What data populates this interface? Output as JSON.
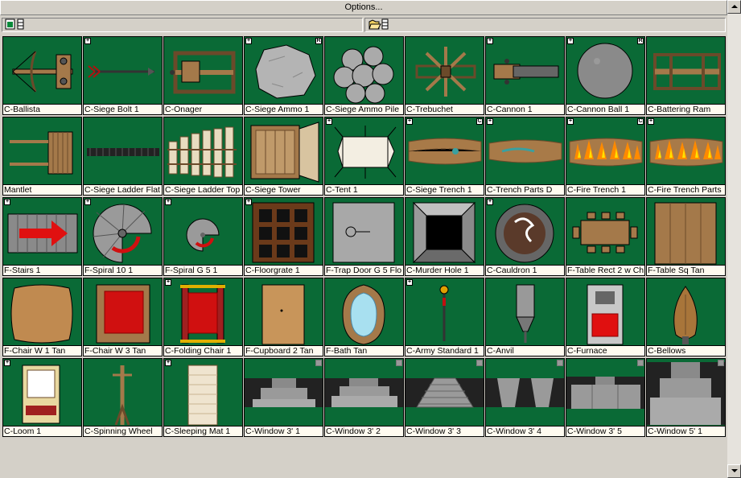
{
  "window": {
    "title": "Options..."
  },
  "colors": {
    "cell_bg": "#0a6a36",
    "panel": "#d4d0c8"
  },
  "symbols": [
    {
      "label": "C-Ballista",
      "badge_l": "",
      "badge_r": "",
      "art": "ballista"
    },
    {
      "label": "C-Siege Bolt 1",
      "badge_l": "+",
      "badge_r": "",
      "art": "bolt"
    },
    {
      "label": "C-Onager",
      "badge_l": "",
      "badge_r": "",
      "art": "onager"
    },
    {
      "label": "C-Siege Ammo 1",
      "badge_l": "+",
      "badge_r": "R",
      "art": "rock"
    },
    {
      "label": "C-Siege Ammo Pile",
      "badge_l": "",
      "badge_r": "",
      "art": "rockpile"
    },
    {
      "label": "C-Trebuchet",
      "badge_l": "",
      "badge_r": "",
      "art": "trebuchet"
    },
    {
      "label": "C-Cannon 1",
      "badge_l": "+",
      "badge_r": "",
      "art": "cannon"
    },
    {
      "label": "C-Cannon Ball 1",
      "badge_l": "+",
      "badge_r": "R",
      "art": "ball"
    },
    {
      "label": "C-Battering Ram",
      "badge_l": "",
      "badge_r": "",
      "art": "ram"
    },
    {
      "label": "Mantlet",
      "badge_l": "",
      "badge_r": "",
      "art": "mantlet"
    },
    {
      "label": "C-Siege Ladder Flat",
      "badge_l": "",
      "badge_r": "",
      "art": "ladderflat"
    },
    {
      "label": "C-Siege Ladder Top",
      "badge_l": "",
      "badge_r": "",
      "art": "laddertop"
    },
    {
      "label": "C-Siege Tower",
      "badge_l": "",
      "badge_r": "",
      "art": "tower"
    },
    {
      "label": "C-Tent 1",
      "badge_l": "+",
      "badge_r": "",
      "art": "tent"
    },
    {
      "label": "C-Siege Trench 1",
      "badge_l": "+",
      "badge_r": "C",
      "art": "trench"
    },
    {
      "label": "C-Trench Parts D",
      "badge_l": "+",
      "badge_r": "",
      "art": "trenchparts"
    },
    {
      "label": "C-Fire Trench 1",
      "badge_l": "+",
      "badge_r": "C",
      "art": "firetrench"
    },
    {
      "label": "C-Fire Trench Parts",
      "badge_l": "+",
      "badge_r": "",
      "art": "firetrench"
    },
    {
      "label": "F-Stairs 1",
      "badge_l": "+",
      "badge_r": "",
      "art": "stairs"
    },
    {
      "label": "F-Spiral 10 1",
      "badge_l": "+",
      "badge_r": "",
      "art": "spiral"
    },
    {
      "label": "F-Spiral G 5 1",
      "badge_l": "+",
      "badge_r": "",
      "art": "spiralsmall"
    },
    {
      "label": "C-Floorgrate 1",
      "badge_l": "+",
      "badge_r": "",
      "art": "grate"
    },
    {
      "label": "F-Trap Door G 5 Flo",
      "badge_l": "",
      "badge_r": "",
      "art": "trapdoor"
    },
    {
      "label": "C-Murder Hole 1",
      "badge_l": "",
      "badge_r": "",
      "art": "murderhole"
    },
    {
      "label": "C-Cauldron 1",
      "badge_l": "+",
      "badge_r": "",
      "art": "cauldron"
    },
    {
      "label": "F-Table Rect 2 w Ch",
      "badge_l": "",
      "badge_r": "",
      "art": "tablerect"
    },
    {
      "label": "F-Table Sq Tan",
      "badge_l": "",
      "badge_r": "",
      "art": "tablesq"
    },
    {
      "label": "F-Chair W 1 Tan",
      "badge_l": "",
      "badge_r": "",
      "art": "cushion"
    },
    {
      "label": "F-Chair W 3 Tan",
      "badge_l": "",
      "badge_r": "",
      "art": "chair3"
    },
    {
      "label": "C-Folding Chair 1",
      "badge_l": "+",
      "badge_r": "",
      "art": "foldchair"
    },
    {
      "label": "F-Cupboard 2 Tan",
      "badge_l": "",
      "badge_r": "",
      "art": "cupboard"
    },
    {
      "label": "F-Bath Tan",
      "badge_l": "",
      "badge_r": "",
      "art": "bath"
    },
    {
      "label": "C-Army Standard 1",
      "badge_l": "+",
      "badge_r": "",
      "art": "standard"
    },
    {
      "label": "C-Anvil",
      "badge_l": "",
      "badge_r": "",
      "art": "anvil"
    },
    {
      "label": "C-Furnace",
      "badge_l": "",
      "badge_r": "",
      "art": "furnace"
    },
    {
      "label": "C-Bellows",
      "badge_l": "",
      "badge_r": "",
      "art": "bellows"
    },
    {
      "label": "C-Loom 1",
      "badge_l": "+",
      "badge_r": "",
      "art": "loom"
    },
    {
      "label": "C-Spinning Wheel",
      "badge_l": "",
      "badge_r": "",
      "art": "spinwheel"
    },
    {
      "label": "C-Sleeping Mat 1",
      "badge_l": "+",
      "badge_r": "",
      "art": "mat"
    },
    {
      "label": "C-Window 3' 1",
      "badge_l": "",
      "badge_r": "g",
      "art": "win1"
    },
    {
      "label": "C-Window 3' 2",
      "badge_l": "",
      "badge_r": "g",
      "art": "win2"
    },
    {
      "label": "C-Window 3' 3",
      "badge_l": "",
      "badge_r": "g",
      "art": "win3"
    },
    {
      "label": "C-Window 3' 4",
      "badge_l": "",
      "badge_r": "g",
      "art": "win4"
    },
    {
      "label": "C-Window 3' 5",
      "badge_l": "",
      "badge_r": "g",
      "art": "win5"
    },
    {
      "label": "C-Window 5' 1",
      "badge_l": "",
      "badge_r": "g",
      "art": "win6"
    }
  ]
}
